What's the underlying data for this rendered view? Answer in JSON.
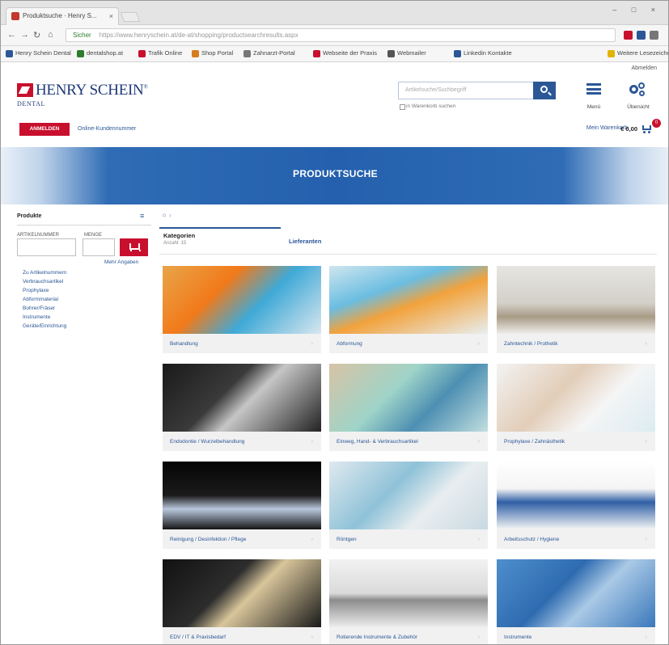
{
  "browser": {
    "tab_title": "Produktsuche · Henry S...",
    "tab_close": "×",
    "window_controls": "– □ ×",
    "nav_back": "←",
    "nav_forward": "→",
    "nav_reload": "↻",
    "nav_home": "⌂",
    "url_secure": "Sicher",
    "url": "https://www.henryschein.at/de-at/shopping/productsearchresults.aspx",
    "bookmarks": [
      {
        "label": "Henry Schein Dental",
        "color": "#2b5797"
      },
      {
        "label": "dentalshop.at",
        "color": "#2c7d2c"
      },
      {
        "label": "Trafik Online",
        "color": "#c8102e"
      },
      {
        "label": "Shop Portal",
        "color": "#d67c1c"
      },
      {
        "label": "Zahnarzt-Portal",
        "color": "#777777"
      },
      {
        "label": "Webseite der Praxis",
        "color": "#c8102e"
      },
      {
        "label": "Webmailer",
        "color": "#555555"
      },
      {
        "label": "Linkedin Kontakte",
        "color": "#2b5797"
      },
      {
        "label": "Weitere Lesezeichen",
        "color": "#e0b400"
      }
    ]
  },
  "header": {
    "top_link": "Abmelden",
    "logo_main": "HENRY SCHEIN",
    "logo_reg": "®",
    "logo_sub": "DENTAL",
    "search_placeholder": "Artikelsuche/Suchbegriff",
    "search_option": "in Warenkorb suchen",
    "menu_label": "Menü",
    "gear_label": "Übersicht",
    "red_button": "ANMELDEN",
    "quick_link": "Online-Kundennummer",
    "cart_text": "Mein Warenkorb",
    "cart_amount": "€ 0,00",
    "cart_count": "0"
  },
  "hero": {
    "title": "PRODUKTSUCHE"
  },
  "sidebar": {
    "title": "Produkte",
    "close": "≡",
    "label_article": "ARTIKELNUMMER",
    "label_qty": "MENGE",
    "more_link": "Mehr Angaben",
    "categories": [
      "Zu Artikelnummern",
      "Verbrauchsartikel",
      "Prophylaxe",
      "Abformmaterial",
      "Bohrer/Fräser",
      "Instrumente",
      "Geräte/Einrichtung"
    ]
  },
  "content": {
    "crumb_home": "⌂",
    "crumb_sep": "›",
    "tab_active": "Kategorien",
    "tab_active_sub": "Anzahl: 15",
    "tab_other": "Lieferanten",
    "cards": [
      {
        "label": "Behandlung",
        "chev": "›",
        "bg": "linear-gradient(135deg,#e8a54a 0%,#f27a1a 35%,#3fa9d6 60%,#d9e7ef 100%)"
      },
      {
        "label": "Abformung",
        "chev": "›",
        "bg": "linear-gradient(160deg,#cfe6ef 0%,#6bbde1 35%,#f2a23c 55%,#e8eef0 100%)"
      },
      {
        "label": "Zahntechnik / Prothetik",
        "chev": "›",
        "bg": "linear-gradient(180deg,#e6e5e2 0%,#d3d0c8 55%,#a89b86 75%,#efeeea 100%)"
      },
      {
        "label": "Endodontie / Wurzelbehandlung",
        "chev": "›",
        "bg": "linear-gradient(135deg,#1a1a1a 0%,#3a3a3a 40%,#c6c6c6 55%,#222 100%)"
      },
      {
        "label": "Einweg, Hand- & Verbrauchsartikel",
        "chev": "›",
        "bg": "linear-gradient(135deg,#d8c3a5 0%,#9fd4c8 40%,#4d8fb2 65%,#c2dfe0 100%)"
      },
      {
        "label": "Prophylaxe / Zahnästhetik",
        "chev": "›",
        "bg": "linear-gradient(135deg,#f3f3f3 0%,#e2cdb8 40%,#f5f5f5 65%,#dcecf2 100%)"
      },
      {
        "label": "Reinigung / Desinfektion / Pflege",
        "chev": "›",
        "bg": "linear-gradient(180deg,#050505 0%,#1b1b1b 50%,#b9c8de 70%,#151515 100%)"
      },
      {
        "label": "Röntgen",
        "chev": "›",
        "bg": "linear-gradient(135deg,#dfe9ee 0%,#8fc2d8 40%,#e9eef0 65%,#c9d9e2 100%)"
      },
      {
        "label": "Arbeitsschutz / Hygiene",
        "chev": "›",
        "bg": "linear-gradient(180deg,#ffffff 0%,#f4f4f4 40%,#2f5fa6 60%,#f5f5f5 100%)"
      },
      {
        "label": "EDV / IT & Praxisbedarf",
        "chev": "›",
        "bg": "linear-gradient(135deg,#111 0%,#2d2d2d 40%,#d8c59a 55%,#1a1a1a 100%)"
      },
      {
        "label": "Rotierende Instrumente & Zubehör",
        "chev": "›",
        "bg": "linear-gradient(180deg,#f2f2f2 0%,#dadada 50%,#8c8c8c 60%,#ededed 100%)"
      },
      {
        "label": "Instrumente",
        "chev": "›",
        "bg": "linear-gradient(135deg,#4f8fcd 0%,#2e6bb0 40%,#aac9e6 60%,#3a78bb 100%)"
      }
    ]
  }
}
